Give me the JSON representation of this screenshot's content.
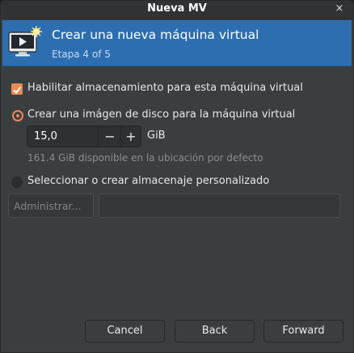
{
  "window": {
    "title": "Nueva MV",
    "close_glyph": "×"
  },
  "header": {
    "title": "Crear una nueva máquina virtual",
    "step": "Etapa 4 of 5",
    "icon": "new-vm-monitor-icon"
  },
  "storage": {
    "enable_label": "Habilitar almacenamiento para esta máquina virtual",
    "enable_checked": true,
    "create_disk_label": "Crear una imágen de disco para la máquina virtual",
    "create_disk_selected": true,
    "size_value": "15,0",
    "size_unit": "GiB",
    "minus_glyph": "−",
    "plus_glyph": "+",
    "available_hint": "161.4 GiB disponible en la ubicación por defecto",
    "custom_label": "Seleccionar o crear almacenaje personalizado",
    "custom_selected": false,
    "manage_label": "Administrar...",
    "custom_path_value": ""
  },
  "footer": {
    "cancel_label": "Cancel",
    "back_label": "Back",
    "forward_label": "Forward"
  },
  "colors": {
    "accent": "#ea8a55",
    "header_bg": "#2d6eb1",
    "window_bg": "#3b3e41"
  }
}
